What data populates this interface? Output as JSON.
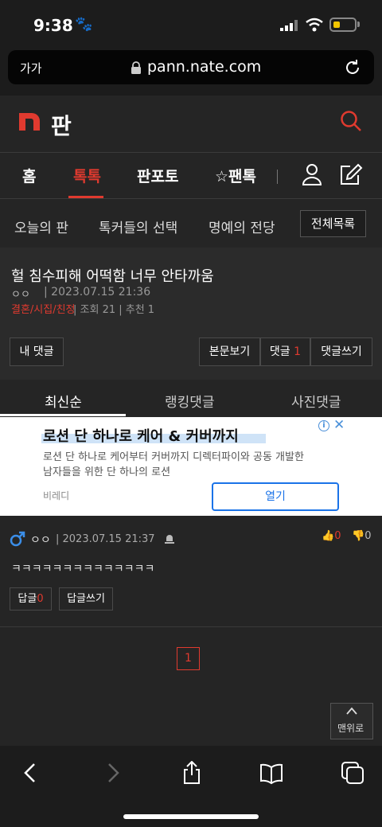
{
  "status_bar": {
    "time": "9:38",
    "paw_glyph": "🐾"
  },
  "browser": {
    "aa_label": "가가",
    "url": "pann.nate.com",
    "lock_icon": "lock-icon",
    "reload_icon": "reload-icon"
  },
  "site": {
    "logo_text": "판",
    "accent": "#e03a2f"
  },
  "main_nav": {
    "home": "홈",
    "toktok": "톡톡",
    "panpoto": "판포토",
    "pantok": "☆팬톡"
  },
  "sub_nav": {
    "today": "오늘의 판",
    "talker": "톡커들의 선택",
    "honor": "명예의 전당",
    "all": "전체목록"
  },
  "post": {
    "title": "헐 침수피해 어떡함 너무 안타까움",
    "author": "ㅇㅇ",
    "date": "| 2023.07.15 21:36",
    "category": "결혼/시집/친정",
    "meta": "| 조회 21 | 추천 1"
  },
  "buttons": {
    "my_comment": "내 댓글",
    "view_body": "본문보기",
    "comment_label": "댓글",
    "comment_count": "1",
    "write_comment": "댓글쓰기"
  },
  "tabs": {
    "newest": "최신순",
    "ranking": "랭킹댓글",
    "photo": "사진댓글"
  },
  "ad": {
    "title": "로션 단 하나로 케어 & 커버까지",
    "info": "i",
    "close": "✕",
    "desc": "로션 단 하나로 케어부터 커버까지 디렉터파이와 공동 개발한 남자들을 위한 단 하나의 로션",
    "brand": "비레디",
    "open": "열기"
  },
  "comment": {
    "author": "ㅇㅇ",
    "date": "| 2023.07.15 21:37",
    "up_count": "0",
    "down_count": "0",
    "text": "ㅋㅋㅋㅋㅋㅋㅋㅋㅋㅋㅋㅋㅋㅋ",
    "reply_label": "답글",
    "reply_count": "0",
    "reply_write": "답글쓰기"
  },
  "pagination": {
    "current": "1"
  },
  "to_top": "맨위로"
}
